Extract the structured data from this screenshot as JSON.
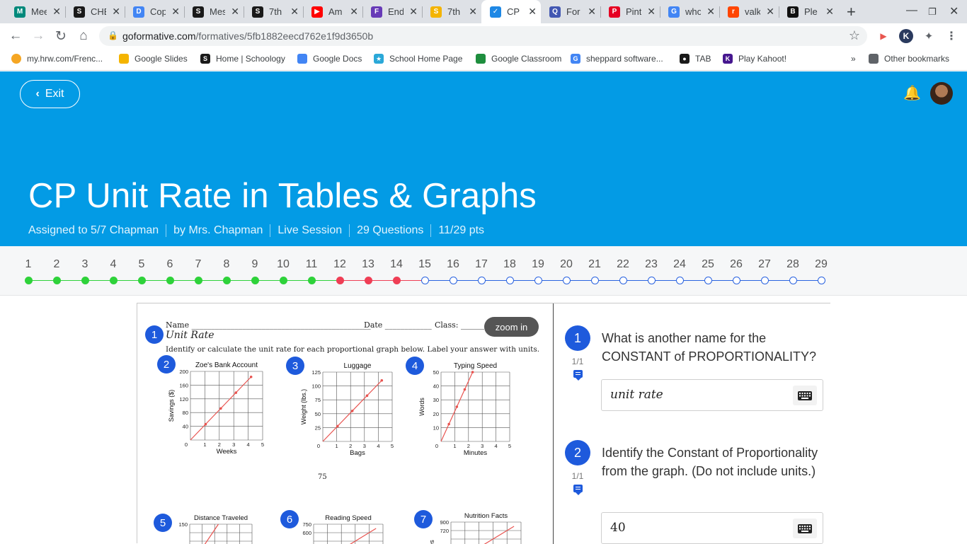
{
  "browser": {
    "tabs": [
      {
        "title": "Mee",
        "icon": "google-meet-icon",
        "color": "#00897b"
      },
      {
        "title": "CHE",
        "icon": "schoology-icon",
        "color": "#1a1a1a"
      },
      {
        "title": "Cop",
        "icon": "google-docs-icon",
        "color": "#4285f4"
      },
      {
        "title": "Mes",
        "icon": "schoology-icon",
        "color": "#1a1a1a"
      },
      {
        "title": "7th",
        "icon": "schoology-icon",
        "color": "#1a1a1a"
      },
      {
        "title": "Am",
        "icon": "youtube-icon",
        "color": "#ff0000"
      },
      {
        "title": "End",
        "icon": "google-forms-icon",
        "color": "#673ab7"
      },
      {
        "title": "7th",
        "icon": "google-slides-icon",
        "color": "#f4b400"
      },
      {
        "title": "CP U",
        "icon": "formative-icon",
        "color": "#1e88e5"
      },
      {
        "title": "For",
        "icon": "quizlet-icon",
        "color": "#4257b2"
      },
      {
        "title": "Pint",
        "icon": "pinterest-icon",
        "color": "#e60023"
      },
      {
        "title": "who",
        "icon": "google-icon",
        "color": "#4285f4"
      },
      {
        "title": "valk",
        "icon": "reddit-icon",
        "color": "#ff4500"
      },
      {
        "title": "Ple",
        "icon": "brainly-icon",
        "color": "#111111"
      }
    ],
    "url_host": "goformative.com",
    "url_path": "/formatives/5fb1882eecd762e1f9d3650b",
    "bookmarks": [
      {
        "label": "my.hrw.com/Frenc...",
        "icon": "hrw-icon",
        "color": "#f5a623"
      },
      {
        "label": "Google Slides",
        "icon": "google-slides-icon",
        "color": "#f4b400"
      },
      {
        "label": "Home | Schoology",
        "icon": "schoology-icon",
        "color": "#1a1a1a"
      },
      {
        "label": "Google Docs",
        "icon": "google-docs-icon",
        "color": "#4285f4"
      },
      {
        "label": "School Home Page",
        "icon": "school-star-icon",
        "color": "#2aa8d8"
      },
      {
        "label": "Google Classroom",
        "icon": "google-classroom-icon",
        "color": "#1e8e3e"
      },
      {
        "label": "sheppard software...",
        "icon": "google-icon",
        "color": "#4285f4"
      },
      {
        "label": "TAB",
        "icon": "globe-icon",
        "color": "#1a1a1a"
      },
      {
        "label": "Play Kahoot!",
        "icon": "kahoot-icon",
        "color": "#46178f"
      }
    ],
    "other_bookmarks": "Other bookmarks"
  },
  "header": {
    "exit_label": "Exit",
    "title": "CP Unit Rate in Tables & Graphs",
    "meta": [
      "Assigned to 5/7 Chapman",
      "by Mrs. Chapman",
      "Live Session",
      "29 Questions",
      "11/29 pts"
    ],
    "accent": "#039be5"
  },
  "progress": {
    "statuses": [
      "correct",
      "correct",
      "correct",
      "correct",
      "correct",
      "correct",
      "correct",
      "correct",
      "correct",
      "correct",
      "correct",
      "incorrect",
      "incorrect",
      "incorrect",
      "unanswered",
      "unanswered",
      "unanswered",
      "unanswered",
      "unanswered",
      "unanswered",
      "unanswered",
      "unanswered",
      "unanswered",
      "unanswered",
      "unanswered",
      "unanswered",
      "unanswered",
      "unanswered",
      "unanswered"
    ],
    "colors": {
      "correct": "#2ed23a",
      "incorrect": "#ef3e55",
      "unanswered": "#2a63e0"
    }
  },
  "worksheet": {
    "zoom_label": "zoom in",
    "name_label": "Name",
    "date_label": "Date",
    "class_label": "Class:",
    "heading": "Unit Rate",
    "instructions": "Identify or calculate the unit rate for each proportional graph below.  Label your answer with units.",
    "page_number": "75",
    "graphs": [
      {
        "num": "2",
        "title": "Zoe's Bank Account",
        "xlabel": "Weeks",
        "ylabel": "Savings ($)",
        "yticks": [
          "200",
          "160",
          "120",
          "80",
          "40"
        ]
      },
      {
        "num": "3",
        "title": "Luggage",
        "xlabel": "Bags",
        "ylabel": "Weight (lbs.)",
        "yticks": [
          "125",
          "100",
          "75",
          "50",
          "25"
        ]
      },
      {
        "num": "4",
        "title": "Typing Speed",
        "xlabel": "Minutes",
        "ylabel": "Words",
        "yticks": [
          "50",
          "40",
          "30",
          "20",
          "10"
        ]
      },
      {
        "num": "5",
        "title": "Distance Traveled",
        "xlabel": "",
        "ylabel": "",
        "yticks": [
          "150"
        ]
      },
      {
        "num": "6",
        "title": "Reading Speed",
        "xlabel": "",
        "ylabel": "",
        "yticks": [
          "750",
          "600"
        ]
      },
      {
        "num": "7",
        "title": "Nutrition Facts",
        "xlabel": "",
        "ylabel": "es",
        "yticks": [
          "900",
          "720"
        ]
      }
    ],
    "xticks": [
      "0",
      "1",
      "2",
      "3",
      "4",
      "5"
    ]
  },
  "questions": [
    {
      "num": "1",
      "score": "1/1",
      "text": "What is another name for the CONSTANT of PROPORTIONALITY?",
      "answer": "unit rate"
    },
    {
      "num": "2",
      "score": "1/1",
      "text": "Identify the Constant of Proportionality from the graph. (Do not include units.)",
      "answer": "40"
    }
  ]
}
